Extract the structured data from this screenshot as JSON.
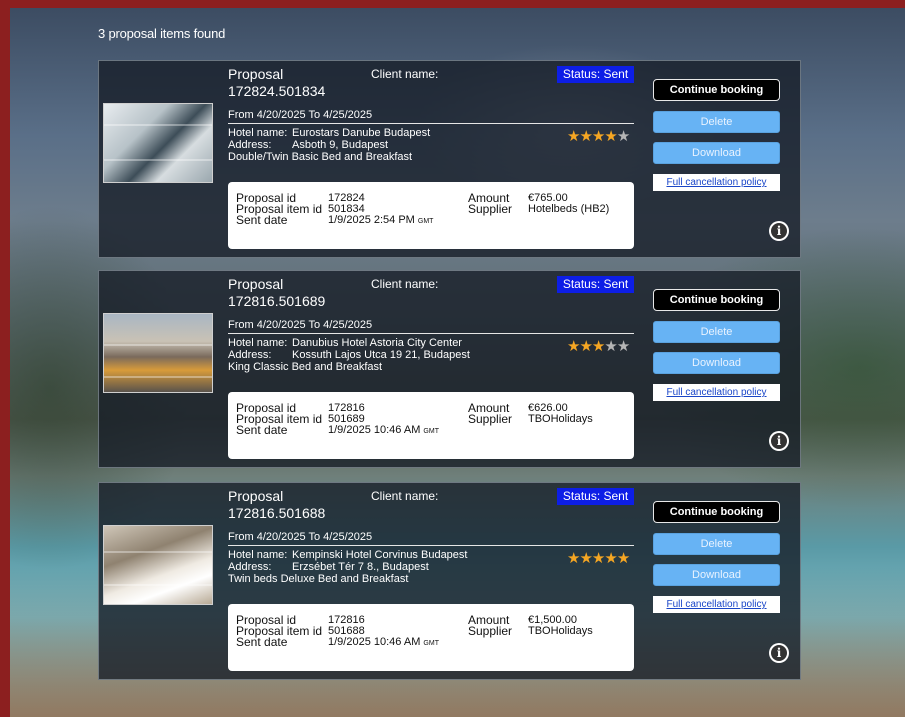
{
  "results_count_text": "3 proposal items found",
  "colors": {
    "status_badge": "#0d1ee6",
    "continue_button": "#000000",
    "action_button": "#67b3f4",
    "star_on": "#f5a623",
    "star_off": "#b5b5b5"
  },
  "labels": {
    "proposal": "Proposal",
    "client_name": "Client name:",
    "hotel_name": "Hotel name:",
    "address": "Address:",
    "proposal_id": "Proposal id",
    "proposal_item_id": "Proposal item id",
    "sent_date": "Sent date",
    "amount": "Amount",
    "supplier": "Supplier",
    "gmt": "GMT",
    "continue_booking": "Continue booking",
    "delete": "Delete",
    "download": "Download",
    "full_cancellation_policy": "Full cancellation policy",
    "info_icon": "i"
  },
  "proposals": [
    {
      "number": "172824.501834",
      "status": "Status: Sent",
      "dates": "From 4/20/2025 To 4/25/2025",
      "hotel_name": "Eurostars Danube Budapest",
      "address": "Asboth 9, Budapest",
      "room": "Double/Twin Basic Bed and Breakfast",
      "rating": 4,
      "proposal_id": "172824",
      "proposal_item_id": "501834",
      "sent_date": "1/9/2025 2:54 PM",
      "amount": "€765.00",
      "supplier": "Hotelbeds (HB2)"
    },
    {
      "number": "172816.501689",
      "status": "Status: Sent",
      "dates": "From 4/20/2025 To 4/25/2025",
      "hotel_name": "Danubius Hotel Astoria City Center",
      "address": "Kossuth Lajos Utca 19 21, Budapest",
      "room": "King Classic Bed and Breakfast",
      "rating": 3,
      "proposal_id": "172816",
      "proposal_item_id": "501689",
      "sent_date": "1/9/2025 10:46 AM",
      "amount": "€626.00",
      "supplier": "TBOHolidays"
    },
    {
      "number": "172816.501688",
      "status": "Status: Sent",
      "dates": "From 4/20/2025 To 4/25/2025",
      "hotel_name": "Kempinski Hotel Corvinus Budapest",
      "address": "Erzsébet Tér 7 8., Budapest",
      "room": "Twin beds Deluxe Bed and Breakfast",
      "rating": 5,
      "proposal_id": "172816",
      "proposal_item_id": "501688",
      "sent_date": "1/9/2025 10:46 AM",
      "amount": "€1,500.00",
      "supplier": "TBOHolidays"
    }
  ]
}
